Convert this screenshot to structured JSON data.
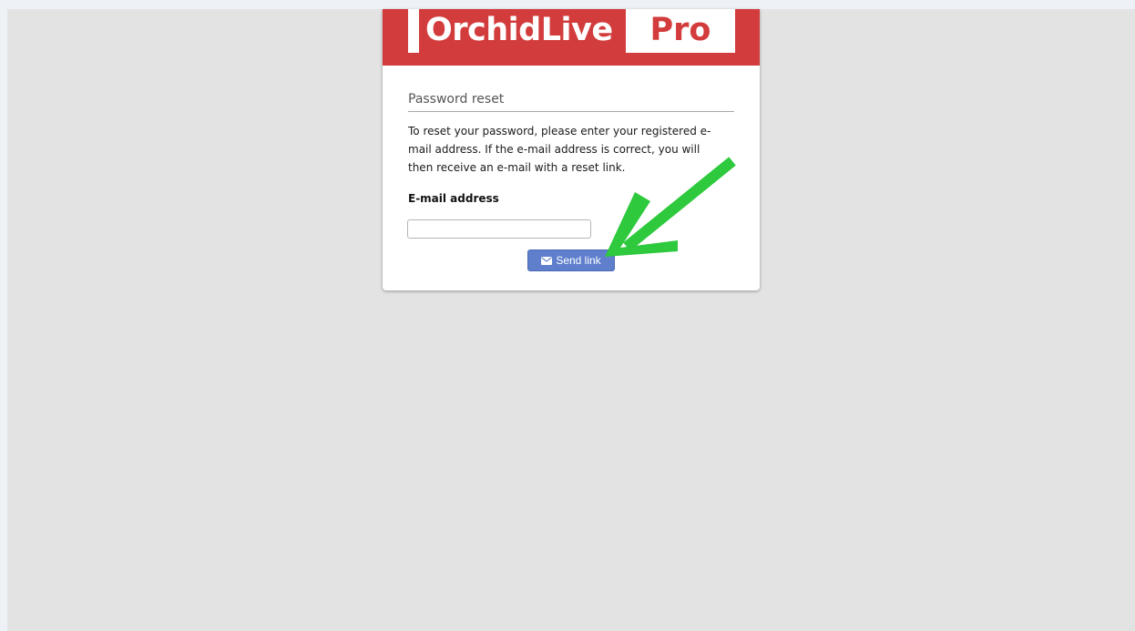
{
  "brand": {
    "name_part1": "OrchidLive",
    "name_part2": "Pro",
    "color": "#d33c3c"
  },
  "reset_form": {
    "title": "Password reset",
    "description": "To reset your password, please enter your registered e-mail address. If the e-mail address is correct, you will then receive an e-mail with a reset link.",
    "email_label": "E-mail address",
    "email_value": "",
    "email_placeholder": "",
    "send_button_label": "Send link",
    "send_button_icon": "envelope-icon",
    "button_color": "#5f7fcd"
  },
  "annotation": {
    "arrow_icon": "arrow-pointer-icon",
    "arrow_color": "#2ec93c"
  }
}
